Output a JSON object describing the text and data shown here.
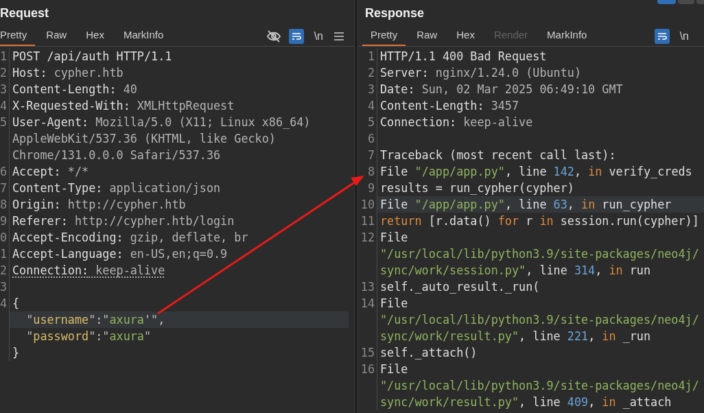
{
  "request": {
    "title": "Request",
    "tabs": [
      {
        "label": "Pretty",
        "selected": true,
        "disabled": false
      },
      {
        "label": "Raw",
        "selected": false,
        "disabled": false
      },
      {
        "label": "Hex",
        "selected": false,
        "disabled": false
      },
      {
        "label": "MarkInfo",
        "selected": false,
        "disabled": false
      }
    ],
    "toolbar": [
      {
        "kind": "hide"
      },
      {
        "kind": "wrap",
        "on": true
      },
      {
        "kind": "text",
        "label": "\\n"
      },
      {
        "kind": "menu"
      }
    ],
    "lines": [
      {
        "number": "1",
        "highlighted": false,
        "underlined": false,
        "parts": [
          {
            "text": "POST /api/auth HTTP/1.1",
            "kind": "plain"
          }
        ]
      },
      {
        "number": "2",
        "highlighted": false,
        "underlined": false,
        "parts": [
          {
            "text": "Host:",
            "kind": "name"
          },
          {
            "text": " cypher.htb",
            "kind": "value"
          }
        ]
      },
      {
        "number": "3",
        "highlighted": false,
        "underlined": false,
        "parts": [
          {
            "text": "Content-Length:",
            "kind": "name"
          },
          {
            "text": " 40",
            "kind": "value"
          }
        ]
      },
      {
        "number": "4",
        "highlighted": false,
        "underlined": false,
        "parts": [
          {
            "text": "X-Requested-With:",
            "kind": "name"
          },
          {
            "text": " XMLHttpRequest",
            "kind": "value"
          }
        ]
      },
      {
        "number": "5",
        "highlighted": false,
        "underlined": false,
        "parts": [
          {
            "text": "User-Agent:",
            "kind": "name"
          },
          {
            "text": " Mozilla/5.0 (X11; Linux x86_64)",
            "kind": "value"
          }
        ]
      },
      {
        "highlighted": false,
        "underlined": false,
        "parts": [
          {
            "text": "AppleWebKit/537.36 (KHTML, like Gecko)",
            "kind": "value"
          }
        ]
      },
      {
        "highlighted": false,
        "underlined": false,
        "parts": [
          {
            "text": "Chrome/131.0.0.0 Safari/537.36",
            "kind": "value"
          }
        ]
      },
      {
        "number": "6",
        "highlighted": false,
        "underlined": false,
        "parts": [
          {
            "text": "Accept:",
            "kind": "name"
          },
          {
            "text": " */*",
            "kind": "value"
          }
        ]
      },
      {
        "number": "7",
        "highlighted": false,
        "underlined": false,
        "parts": [
          {
            "text": "Content-Type:",
            "kind": "name"
          },
          {
            "text": " application/json",
            "kind": "value"
          }
        ]
      },
      {
        "number": "8",
        "highlighted": false,
        "underlined": false,
        "parts": [
          {
            "text": "Origin:",
            "kind": "name"
          },
          {
            "text": " http://cypher.htb",
            "kind": "value"
          }
        ]
      },
      {
        "number": "9",
        "highlighted": false,
        "underlined": false,
        "parts": [
          {
            "text": "Referer:",
            "kind": "name"
          },
          {
            "text": " http://cypher.htb/login",
            "kind": "value"
          }
        ]
      },
      {
        "number": "0",
        "highlighted": false,
        "underlined": false,
        "parts": [
          {
            "text": "Accept-Encoding:",
            "kind": "name"
          },
          {
            "text": " gzip, deflate, br",
            "kind": "value"
          }
        ]
      },
      {
        "number": "1",
        "highlighted": false,
        "underlined": false,
        "parts": [
          {
            "text": "Accept-Language:",
            "kind": "name"
          },
          {
            "text": " en-US,en;q=0.9",
            "kind": "value"
          }
        ]
      },
      {
        "number": "2",
        "highlighted": false,
        "underlined": true,
        "parts": [
          {
            "text": "Connection:",
            "kind": "name"
          },
          {
            "text": " keep-alive",
            "kind": "value"
          }
        ]
      },
      {
        "number": "3",
        "highlighted": false
      },
      {
        "number": "4",
        "highlighted": false,
        "underlined": false,
        "parts": [
          {
            "text": "{",
            "kind": "plain"
          }
        ]
      },
      {
        "highlighted": true,
        "underlined": false,
        "parts": [
          {
            "text": "  \"",
            "kind": "punct"
          },
          {
            "text": "username",
            "kind": "json-key"
          },
          {
            "text": "\":\"",
            "kind": "punct"
          },
          {
            "text": "axura",
            "kind": "string"
          },
          {
            "text": "'\",",
            "kind": "punct"
          }
        ]
      },
      {
        "highlighted": false,
        "underlined": false,
        "parts": [
          {
            "text": "  \"",
            "kind": "punct"
          },
          {
            "text": "password",
            "kind": "json-key"
          },
          {
            "text": "\":\"",
            "kind": "punct"
          },
          {
            "text": "axura",
            "kind": "string"
          },
          {
            "text": "\"",
            "kind": "punct"
          }
        ]
      },
      {
        "highlighted": false,
        "underlined": false,
        "parts": [
          {
            "text": "}",
            "kind": "plain"
          }
        ]
      }
    ]
  },
  "response": {
    "title": "Response",
    "tabs": [
      {
        "label": "Pretty",
        "selected": true,
        "disabled": false
      },
      {
        "label": "Raw",
        "selected": false,
        "disabled": false
      },
      {
        "label": "Hex",
        "selected": false,
        "disabled": false
      },
      {
        "label": "Render",
        "selected": false,
        "disabled": true
      },
      {
        "label": "MarkInfo",
        "selected": false,
        "disabled": false
      }
    ],
    "toolbar": [
      {
        "kind": "wrap",
        "on": true
      },
      {
        "kind": "text",
        "label": "\\n"
      }
    ],
    "lines": [
      {
        "number": "1",
        "highlighted": false,
        "parts": [
          {
            "text": "HTTP/1.1 400 Bad Request",
            "kind": "plain"
          }
        ]
      },
      {
        "number": "2",
        "highlighted": false,
        "parts": [
          {
            "text": "Server:",
            "kind": "name"
          },
          {
            "text": " nginx/1.24.0 (Ubuntu)",
            "kind": "value"
          }
        ]
      },
      {
        "number": "3",
        "highlighted": false,
        "parts": [
          {
            "text": "Date:",
            "kind": "name"
          },
          {
            "text": " Sun, 02 Mar 2025 06:49:10 GMT",
            "kind": "value"
          }
        ]
      },
      {
        "number": "4",
        "highlighted": false,
        "parts": [
          {
            "text": "Content-Length:",
            "kind": "name"
          },
          {
            "text": " 3457",
            "kind": "value"
          }
        ]
      },
      {
        "number": "5",
        "highlighted": false,
        "parts": [
          {
            "text": "Connection:",
            "kind": "name"
          },
          {
            "text": " keep-alive",
            "kind": "value"
          }
        ]
      },
      {
        "number": "6",
        "highlighted": false
      },
      {
        "number": "7",
        "highlighted": false,
        "parts": [
          {
            "text": "Traceback (most recent call last):",
            "kind": "plain"
          }
        ]
      },
      {
        "number": "8",
        "highlighted": false,
        "parts": [
          {
            "text": "File ",
            "kind": "plain"
          },
          {
            "text": "\"/app/app.py\"",
            "kind": "string"
          },
          {
            "text": ", line ",
            "kind": "plain"
          },
          {
            "text": "142",
            "kind": "number"
          },
          {
            "text": ", ",
            "kind": "plain"
          },
          {
            "text": "in",
            "kind": "keyword"
          },
          {
            "text": " verify_creds",
            "kind": "plain"
          }
        ]
      },
      {
        "number": "9",
        "highlighted": false,
        "parts": [
          {
            "text": "results = run_cypher(cypher)",
            "kind": "plain"
          }
        ]
      },
      {
        "number": "10",
        "highlighted": true,
        "parts": [
          {
            "text": "File ",
            "kind": "plain"
          },
          {
            "text": "\"/app/app.py\"",
            "kind": "string"
          },
          {
            "text": ", line ",
            "kind": "plain"
          },
          {
            "text": "63",
            "kind": "number"
          },
          {
            "text": ", ",
            "kind": "plain"
          },
          {
            "text": "in",
            "kind": "keyword"
          },
          {
            "text": " run_cypher",
            "kind": "plain"
          }
        ]
      },
      {
        "number": "11",
        "highlighted": false,
        "parts": [
          {
            "text": "return",
            "kind": "keyword"
          },
          {
            "text": " [r.data() ",
            "kind": "plain"
          },
          {
            "text": "for",
            "kind": "keyword"
          },
          {
            "text": " r ",
            "kind": "plain"
          },
          {
            "text": "in",
            "kind": "keyword"
          },
          {
            "text": " session.run(cypher)]",
            "kind": "plain"
          }
        ]
      },
      {
        "number": "12",
        "highlighted": false,
        "parts": [
          {
            "text": "File",
            "kind": "plain"
          }
        ]
      },
      {
        "highlighted": false,
        "parts": [
          {
            "text": "\"/usr/local/lib/python3.9/site-packages/neo4j/",
            "kind": "string"
          }
        ]
      },
      {
        "highlighted": false,
        "parts": [
          {
            "text": "sync/work/session.py\"",
            "kind": "string"
          },
          {
            "text": ", line ",
            "kind": "plain"
          },
          {
            "text": "314",
            "kind": "number"
          },
          {
            "text": ", ",
            "kind": "plain"
          },
          {
            "text": "in",
            "kind": "keyword"
          },
          {
            "text": " run",
            "kind": "plain"
          }
        ]
      },
      {
        "number": "13",
        "highlighted": false,
        "parts": [
          {
            "text": "self._auto_result._run(",
            "kind": "plain"
          }
        ]
      },
      {
        "number": "14",
        "highlighted": false,
        "parts": [
          {
            "text": "File",
            "kind": "plain"
          }
        ]
      },
      {
        "highlighted": false,
        "parts": [
          {
            "text": "\"/usr/local/lib/python3.9/site-packages/neo4j/",
            "kind": "string"
          }
        ]
      },
      {
        "highlighted": false,
        "parts": [
          {
            "text": "sync/work/result.py\"",
            "kind": "string"
          },
          {
            "text": ", line ",
            "kind": "plain"
          },
          {
            "text": "221",
            "kind": "number"
          },
          {
            "text": ", ",
            "kind": "plain"
          },
          {
            "text": "in",
            "kind": "keyword"
          },
          {
            "text": " _run",
            "kind": "plain"
          }
        ]
      },
      {
        "number": "15",
        "highlighted": false,
        "parts": [
          {
            "text": "self._attach()",
            "kind": "plain"
          }
        ]
      },
      {
        "number": "16",
        "highlighted": false,
        "parts": [
          {
            "text": "File",
            "kind": "plain"
          }
        ]
      },
      {
        "highlighted": false,
        "parts": [
          {
            "text": "\"/usr/local/lib/python3.9/site-packages/neo4j/",
            "kind": "string"
          }
        ]
      },
      {
        "highlighted": false,
        "parts": [
          {
            "text": "sync/work/result.py\"",
            "kind": "string"
          },
          {
            "text": ", line ",
            "kind": "plain"
          },
          {
            "text": "409",
            "kind": "number"
          },
          {
            "text": ", ",
            "kind": "plain"
          },
          {
            "text": "in",
            "kind": "keyword"
          },
          {
            "text": " _attach",
            "kind": "plain"
          }
        ]
      }
    ]
  }
}
